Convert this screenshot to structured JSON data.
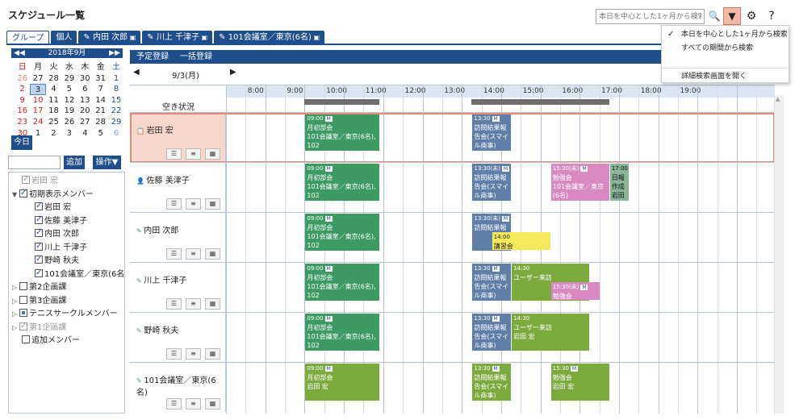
{
  "header": {
    "title": "スケジュール一覧",
    "search_placeholder": "本日を中心とした1ヶ月から検索"
  },
  "tabs": [
    {
      "label": "グループ",
      "icon": ""
    },
    {
      "label": "個人",
      "icon": ""
    },
    {
      "label": "内田 次郎",
      "icon": "pencil-icon"
    },
    {
      "label": "川上 千津子",
      "icon": "pencil-icon"
    },
    {
      "label": "101会議室／東京(6名)",
      "icon": "pencil-icon"
    }
  ],
  "calendar": {
    "month_label": "2018年9月",
    "weekdays": [
      "日",
      "月",
      "火",
      "水",
      "木",
      "金",
      "土"
    ],
    "days": [
      [
        "26",
        "27",
        "28",
        "29",
        "30",
        "31",
        "1"
      ],
      [
        "2",
        "3",
        "4",
        "5",
        "6",
        "7",
        "8"
      ],
      [
        "9",
        "10",
        "11",
        "12",
        "13",
        "14",
        "15"
      ],
      [
        "16",
        "17",
        "18",
        "19",
        "20",
        "21",
        "22"
      ],
      [
        "23",
        "24",
        "25",
        "26",
        "27",
        "28",
        "29"
      ],
      [
        "30",
        "1",
        "2",
        "3",
        "4",
        "5",
        "6"
      ]
    ],
    "today_label": "今日"
  },
  "member_controls": {
    "add_label": "追加",
    "ops_label": "操作▼"
  },
  "tree": [
    {
      "label": "岩田 宏",
      "level": 1,
      "state": "grey",
      "arrow": ""
    },
    {
      "label": "初期表示メンバー",
      "level": 0,
      "state": "on",
      "arrow": "▼"
    },
    {
      "label": "岩田 宏",
      "level": 2,
      "state": "on",
      "arrow": ""
    },
    {
      "label": "佐藤 美津子",
      "level": 2,
      "state": "on",
      "arrow": ""
    },
    {
      "label": "内田 次郎",
      "level": 2,
      "state": "on",
      "arrow": ""
    },
    {
      "label": "川上 千津子",
      "level": 2,
      "state": "on",
      "arrow": ""
    },
    {
      "label": "野崎 秋夫",
      "level": 2,
      "state": "on",
      "arrow": ""
    },
    {
      "label": "101会議室／東京(6名)",
      "level": 2,
      "state": "on",
      "arrow": ""
    },
    {
      "label": "第2企画課",
      "level": 0,
      "state": "off",
      "arrow": "▷"
    },
    {
      "label": "第3企画課",
      "level": 0,
      "state": "off",
      "arrow": "▷"
    },
    {
      "label": "テニスサークルメンバー",
      "level": 0,
      "state": "part",
      "arrow": "▷"
    },
    {
      "label": "第1企画課",
      "level": 0,
      "state": "grey",
      "arrow": "▷"
    },
    {
      "label": "追加メンバー",
      "level": 1,
      "state": "off",
      "arrow": ""
    }
  ],
  "main": {
    "register_label": "予定登録",
    "bulk_label": "一括登録",
    "date_label": "9/3(月)",
    "availability_label": "空き状況",
    "hours": [
      "8:00",
      "9:00",
      "10:00",
      "11:00",
      "12:00",
      "13:00",
      "14:00",
      "15:00",
      "16:00",
      "17:00",
      "18:00",
      "19:00"
    ]
  },
  "rows": [
    {
      "name": "岩田 宏",
      "icon": "memo-icon",
      "selected": true,
      "events": [
        {
          "start": 9.0,
          "end": 10.9,
          "color": "green",
          "lines": [
            "09:00",
            "月初部会",
            "101会議室／東京(6名), 102"
          ],
          "mb": true
        },
        {
          "start": 13.25,
          "end": 14.25,
          "color": "blue",
          "lines": [
            "13:30",
            "訪問結果報",
            "告会(スマイ",
            "ル商事)",
            "101会議室"
          ],
          "mb": true
        }
      ]
    },
    {
      "name": "佐藤 美津子",
      "icon": "person-icon",
      "selected": false,
      "events": [
        {
          "start": 9.0,
          "end": 10.9,
          "color": "green",
          "lines": [
            "09:00",
            "月初部会",
            "101会議室／東京(6名), 102"
          ],
          "mb": true
        },
        {
          "start": 13.25,
          "end": 14.25,
          "color": "blue",
          "lines": [
            "13:30(未)",
            "訪問結果報",
            "告会(スマイ",
            "ル商事)",
            "101会議室"
          ],
          "mb": true
        },
        {
          "start": 15.25,
          "end": 16.75,
          "color": "pink",
          "lines": [
            "15:30(未)",
            "勉強会",
            "101会議室／東京(6名)"
          ],
          "mb": true
        },
        {
          "start": 16.75,
          "end": 17.25,
          "color": "grey",
          "lines": [
            "17:00",
            "日報",
            "作成",
            "岩田"
          ],
          "mb": false
        }
      ]
    },
    {
      "name": "内田 次郎",
      "icon": "pencil-icon",
      "selected": false,
      "events": [
        {
          "start": 9.0,
          "end": 10.9,
          "color": "green",
          "lines": [
            "09:00",
            "月初部会",
            "101会議室／東京(6名), 102"
          ],
          "mb": true
        },
        {
          "start": 13.25,
          "end": 14.25,
          "color": "blue",
          "lines": [
            "13:30(未)",
            "訪問結果報"
          ],
          "mb": true
        },
        {
          "start": 13.75,
          "end": 15.25,
          "color": "yellow",
          "lines": [
            "14:00",
            "講習会"
          ],
          "mb": false
        }
      ]
    },
    {
      "name": "川上 千津子",
      "icon": "pencil-icon",
      "selected": false,
      "events": [
        {
          "start": 9.0,
          "end": 10.9,
          "color": "green",
          "lines": [
            "09:00",
            "月初部会",
            "101会議室／東京(6名), 102"
          ],
          "mb": true
        },
        {
          "start": 13.25,
          "end": 14.25,
          "color": "blue",
          "lines": [
            "13:30",
            "訪問結果報",
            "告会(スマイ",
            "ル商事)"
          ],
          "mb": true
        },
        {
          "start": 14.25,
          "end": 16.25,
          "color": "lime",
          "lines": [
            "14:30",
            "ユーザー来訪"
          ],
          "mb": false
        },
        {
          "start": 15.25,
          "end": 16.5,
          "color": "pink",
          "lines": [
            "15:30(未)",
            "勉強会"
          ],
          "mb": true
        }
      ]
    },
    {
      "name": "野崎 秋夫",
      "icon": "pencil-icon",
      "selected": false,
      "events": [
        {
          "start": 9.0,
          "end": 10.9,
          "color": "green",
          "lines": [
            "09:00",
            "月初部会",
            "101会議室／東京(6名), 102"
          ],
          "mb": true
        },
        {
          "start": 13.25,
          "end": 14.25,
          "color": "blue",
          "lines": [
            "13:30",
            "訪問結果報",
            "告会(スマイ",
            "ル商事)",
            "岩田 宏"
          ],
          "mb": true
        },
        {
          "start": 14.25,
          "end": 16.25,
          "color": "lime",
          "lines": [
            "14:30",
            "ユーザー来訪",
            "岩田 宏"
          ],
          "mb": false
        }
      ]
    },
    {
      "name": "101会議室／東京(6名)",
      "icon": "pencil-icon",
      "selected": false,
      "events": [
        {
          "start": 9.0,
          "end": 10.9,
          "color": "lime",
          "lines": [
            "09:00",
            "月初部会",
            "岩田 宏"
          ],
          "mb": true
        },
        {
          "start": 13.25,
          "end": 14.25,
          "color": "lime",
          "lines": [
            "13:30",
            "訪問結果報",
            "告会(スマイ",
            "ル商事)",
            "岩田 宏"
          ],
          "mb": true
        },
        {
          "start": 15.25,
          "end": 16.75,
          "color": "lime",
          "lines": [
            "15:30",
            "勉強会",
            "岩田 宏"
          ],
          "mb": true
        }
      ]
    }
  ],
  "dropdown": {
    "items": [
      {
        "label": "本日を中心とした1ヶ月から検索",
        "checked": true
      },
      {
        "label": "すべての期間から検索",
        "checked": false
      },
      {
        "label": "詳細検索画面を開く",
        "checked": false
      }
    ]
  },
  "colors": {
    "accent": "#1e4e8c",
    "selected_row": "#f7d7cb"
  }
}
